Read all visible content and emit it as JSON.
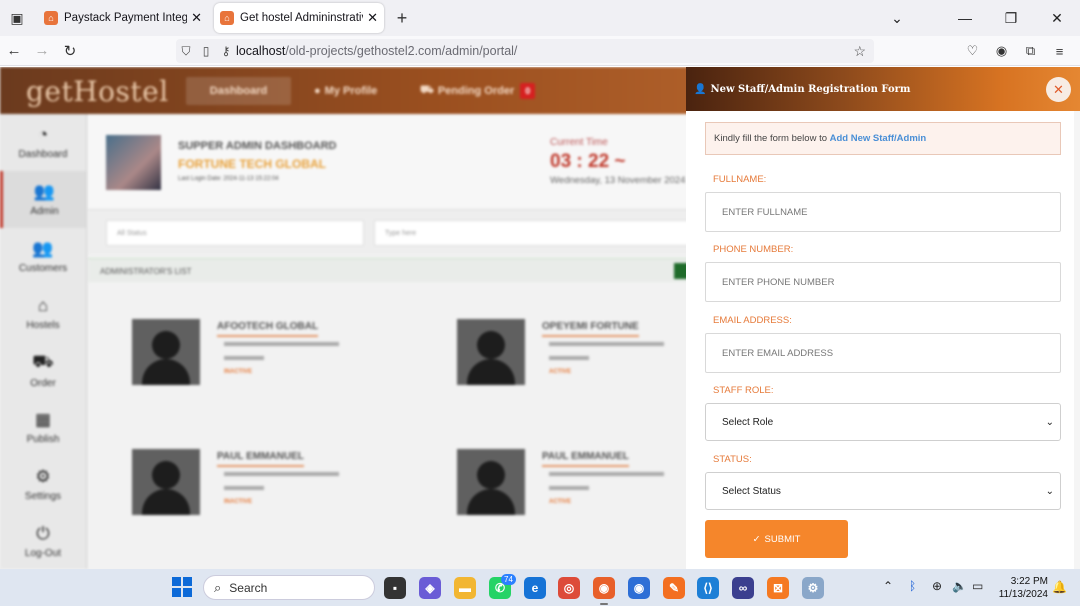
{
  "browser": {
    "tabs": [
      {
        "title": "Paystack Payment Integration T",
        "active": false
      },
      {
        "title": "Get hostel Admininstrative Logi",
        "active": true
      }
    ],
    "url_host": "localhost",
    "url_path": "/old-projects/gethostel2.com/admin/portal/"
  },
  "app": {
    "logo": "getHostel",
    "nav": {
      "dashboard": "Dashboard",
      "profile": "My Profile",
      "pending": "Pending Order",
      "pending_count": "0"
    },
    "sidebar": [
      "Dashboard",
      "Admin",
      "Customers",
      "Hostels",
      "Order",
      "Publish",
      "Settings",
      "Log-Out"
    ],
    "header": {
      "dash_title": "SUPPER ADMIN DASHBOARD",
      "org": "FORTUNE TECH GLOBAL",
      "last_login": "Last Login Date: 2024-11-13 15:22:04",
      "time_label": "Current Time",
      "time": "03 : 22 ~",
      "date": "Wednesday, 13 November 2024"
    },
    "filters": {
      "status_placeholder": "All Status",
      "search_placeholder": "Type here"
    },
    "list_title": "ADMINISTRATOR'S LIST",
    "cards": [
      {
        "name": "AFOOTECH GLOBAL",
        "status": "INACTIVE"
      },
      {
        "name": "OPEYEMI FORTUNE",
        "status": "ACTIVE"
      },
      {
        "name": "PAUL EMMANUEL",
        "status": "INACTIVE"
      },
      {
        "name": "PAUL EMMANUEL",
        "status": "ACTIVE"
      }
    ]
  },
  "form": {
    "title": "New Staff/Admin Registration Form",
    "notice_text": "Kindly fill the form below to ",
    "notice_link": "Add New Staff/Admin",
    "fullname_label": "FULLNAME:",
    "fullname_placeholder": "ENTER FULLNAME",
    "phone_label": "PHONE NUMBER:",
    "phone_placeholder": "ENTER PHONE NUMBER",
    "email_label": "EMAIL ADDRESS:",
    "email_placeholder": "ENTER EMAIL ADDRESS",
    "role_label": "STAFF ROLE:",
    "role_value": "Select Role",
    "status_label": "STATUS:",
    "status_value": "Select Status",
    "submit_label": "SUBMIT"
  },
  "taskbar": {
    "search": "Search",
    "whatsapp_badge": "74",
    "time": "3:22 PM",
    "date": "11/13/2024"
  },
  "colors": {
    "accent": "#f5862b",
    "label": "#e67a3a",
    "link": "#4a8fd6"
  }
}
